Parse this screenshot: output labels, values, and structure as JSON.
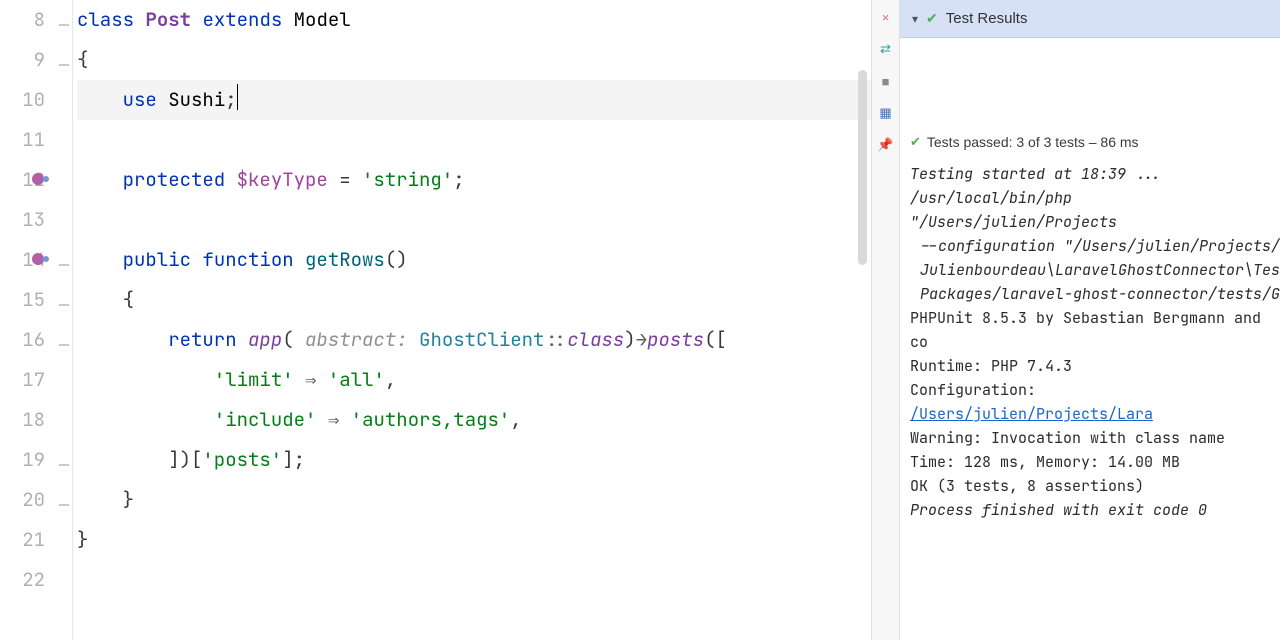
{
  "first_line": 8,
  "editor": {
    "lines": [
      {
        "seg": [
          [
            "kw",
            "class"
          ],
          [
            "",
            " "
          ],
          [
            "type",
            "Post"
          ],
          [
            "",
            " "
          ],
          [
            "kw",
            "extends"
          ],
          [
            "",
            " "
          ],
          [
            "type2",
            "Model"
          ]
        ]
      },
      {
        "seg": [
          [
            "",
            "{"
          ]
        ]
      },
      {
        "hl": true,
        "seg": [
          [
            "",
            "    "
          ],
          [
            "kw",
            "use"
          ],
          [
            "",
            " "
          ],
          [
            "type2",
            "Sushi"
          ],
          [
            "",
            ";"
          ]
        ],
        "cursor": true
      },
      {
        "seg": [
          [
            "",
            ""
          ]
        ]
      },
      {
        "seg": [
          [
            "",
            "    "
          ],
          [
            "kw",
            "protected"
          ],
          [
            "",
            " "
          ],
          [
            "var",
            "$keyType"
          ],
          [
            "",
            " = "
          ],
          [
            "str",
            "'string'"
          ],
          [
            "",
            ";"
          ]
        ]
      },
      {
        "seg": [
          [
            "",
            ""
          ]
        ]
      },
      {
        "seg": [
          [
            "",
            "    "
          ],
          [
            "kw",
            "public"
          ],
          [
            "",
            " "
          ],
          [
            "kw",
            "function"
          ],
          [
            "",
            " "
          ],
          [
            "fnname",
            "getRows"
          ],
          [
            "",
            "()"
          ]
        ]
      },
      {
        "seg": [
          [
            "",
            "    {"
          ]
        ]
      },
      {
        "seg": [
          [
            "",
            "        "
          ],
          [
            "kw",
            "return"
          ],
          [
            "",
            " "
          ],
          [
            "fn",
            "app"
          ],
          [
            "",
            "( "
          ],
          [
            "hint",
            "abstract:"
          ],
          [
            "",
            " "
          ],
          [
            "cls",
            "GhostClient"
          ],
          [
            "kwsoft",
            "::"
          ],
          [
            "fn",
            "class"
          ],
          [
            "",
            ")"
          ],
          [
            "arrow",
            "→"
          ],
          [
            "fn",
            "posts"
          ],
          [
            "",
            "(["
          ]
        ]
      },
      {
        "seg": [
          [
            "",
            "            "
          ],
          [
            "str",
            "'limit'"
          ],
          [
            "",
            " "
          ],
          [
            "arrow",
            "⇒"
          ],
          [
            "",
            " "
          ],
          [
            "str",
            "'all'"
          ],
          [
            "",
            ","
          ]
        ]
      },
      {
        "seg": [
          [
            "",
            "            "
          ],
          [
            "str",
            "'include'"
          ],
          [
            "",
            " "
          ],
          [
            "arrow",
            "⇒"
          ],
          [
            "",
            " "
          ],
          [
            "str",
            "'authors,tags'"
          ],
          [
            "",
            ","
          ]
        ]
      },
      {
        "seg": [
          [
            "",
            "        ])["
          ],
          [
            "str",
            "'posts'"
          ],
          [
            "",
            "];"
          ]
        ]
      },
      {
        "seg": [
          [
            "",
            "    }"
          ]
        ]
      },
      {
        "seg": [
          [
            "",
            "}"
          ]
        ]
      },
      {
        "seg": [
          [
            "",
            ""
          ]
        ]
      }
    ]
  },
  "toolstrip": [
    "×",
    "⇄",
    "■",
    "▦",
    "📌"
  ],
  "toolstrip_colors": [
    "#e06c75",
    "#2aa198",
    "#8a8a8a",
    "#4a6fb5",
    "#a874b8"
  ],
  "panel": {
    "title": "Test Results",
    "summary": "Tests passed: 3 of 3 tests – 86 ms",
    "console": [
      {
        "i": true,
        "t": "Testing started at 18:39 ..."
      },
      {
        "i": true,
        "t": "/usr/local/bin/php \"/Users/julien/Projects"
      },
      {
        "i": true,
        "indent": true,
        "t": "--configuration \"/Users/julien/Projects/"
      },
      {
        "i": true,
        "indent": true,
        "t": "Julienbourdeau\\LaravelGhostConnector\\Tes"
      },
      {
        "i": true,
        "indent": true,
        "t": "Packages/laravel-ghost-connector/tests/G"
      },
      {
        "t": "PHPUnit 8.5.3 by Sebastian Bergmann and co"
      },
      {
        "t": " "
      },
      {
        "t": "Runtime:       PHP 7.4.3"
      },
      {
        "html": "Configuration: <a href='#'>/Users/julien/Projects/Lara</a>"
      },
      {
        "t": "Warning:       Invocation with class name "
      },
      {
        "t": " "
      },
      {
        "t": " "
      },
      {
        "t": " "
      },
      {
        "t": "Time: 128 ms, Memory: 14.00 MB"
      },
      {
        "t": " "
      },
      {
        "t": "OK (3 tests, 8 assertions)"
      },
      {
        "t": " "
      },
      {
        "i": true,
        "t": "Process finished with exit code 0"
      }
    ]
  }
}
